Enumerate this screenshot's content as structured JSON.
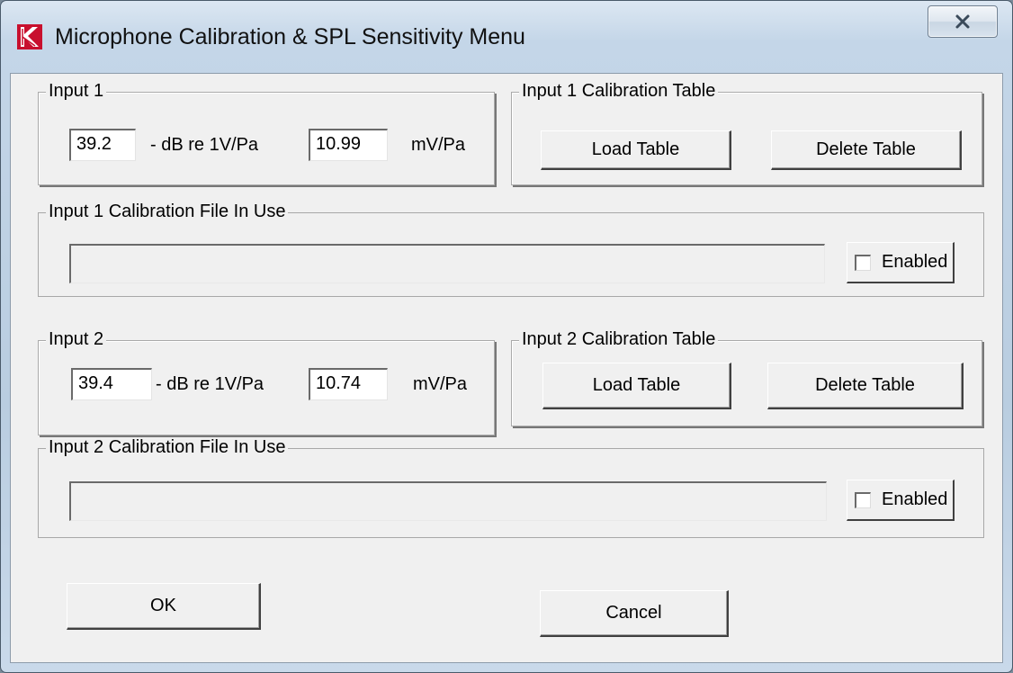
{
  "window": {
    "title": "Microphone Calibration & SPL Sensitivity Menu"
  },
  "input1": {
    "group_label": "Input 1",
    "db_value": "39.2",
    "db_unit": "- dB re 1V/Pa",
    "mv_value": "10.99",
    "mv_unit": "mV/Pa"
  },
  "input1_table": {
    "group_label": "Input 1 Calibration Table",
    "load_label": "Load Table",
    "delete_label": "Delete Table"
  },
  "input1_file": {
    "group_label": "Input 1 Calibration File In Use",
    "file_value": "",
    "enabled_label": "Enabled",
    "enabled": false
  },
  "input2": {
    "group_label": "Input 2",
    "db_value": "39.4",
    "db_unit": "- dB re 1V/Pa",
    "mv_value": "10.74",
    "mv_unit": "mV/Pa"
  },
  "input2_table": {
    "group_label": "Input 2 Calibration Table",
    "load_label": "Load Table",
    "delete_label": "Delete Table"
  },
  "input2_file": {
    "group_label": "Input 2 Calibration File In Use",
    "file_value": "",
    "enabled_label": "Enabled",
    "enabled": false
  },
  "footer": {
    "ok_label": "OK",
    "cancel_label": "Cancel"
  },
  "icons": {
    "app": "app-logo-icon",
    "close": "close-icon"
  },
  "colors": {
    "app_icon_red": "#c8102e",
    "dialog_bg": "#f0f0f0"
  }
}
